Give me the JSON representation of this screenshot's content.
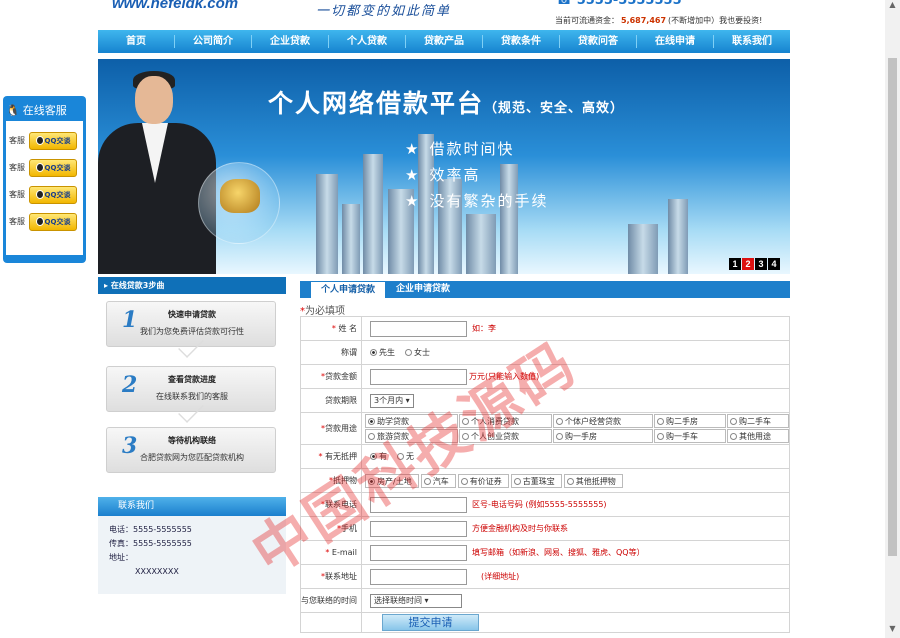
{
  "header": {
    "logo": "www.hefeidk.com",
    "slogan": "一切都变的如此简单",
    "hotline": "5555-5555555",
    "funds_label": "当前可流通资金：",
    "funds_value": "5,687,467",
    "funds_note": "(不断增加中）我也要投资!"
  },
  "nav": [
    "首页",
    "公司简介",
    "企业贷款",
    "个人贷款",
    "贷款产品",
    "贷款条件",
    "贷款问答",
    "在线申请",
    "联系我们"
  ],
  "banner": {
    "title": "个人网络借款平台",
    "subtitle": "（规范、安全、高效）",
    "points": [
      "借款时间快",
      "效率高",
      "没有繁杂的手续"
    ],
    "pages": [
      "1",
      "2",
      "3",
      "4"
    ]
  },
  "qq": {
    "title": "在线客服",
    "items": [
      {
        "label": "客服",
        "btn": "QQ交谈"
      },
      {
        "label": "客服",
        "btn": "QQ交谈"
      },
      {
        "label": "客服",
        "btn": "QQ交谈"
      },
      {
        "label": "客服",
        "btn": "QQ交谈"
      }
    ]
  },
  "steps": {
    "title": "在线贷款3步曲",
    "items": [
      {
        "num": "1",
        "title": "快速申请贷款",
        "desc": "我们为您免费评估贷款可行性"
      },
      {
        "num": "2",
        "title": "查看贷款进度",
        "desc": "在线联系我们的客服"
      },
      {
        "num": "3",
        "title": "等待机构联络",
        "desc": "合肥贷款网为您匹配贷款机构"
      }
    ]
  },
  "contact": {
    "title": "联系我们",
    "phone": "电话：5555-5555555",
    "fax": "传真：5555-5555555",
    "address_label": "地址：",
    "address": "XXXXXXXX"
  },
  "form": {
    "tabs": [
      "个人申请贷款",
      "企业申请贷款"
    ],
    "required_note": "为必填项",
    "name_label": "姓 名",
    "name_hint": "如：李",
    "title_label": "称谓",
    "title_opts": [
      "先生",
      "女士"
    ],
    "amount_label": "贷款金额",
    "amount_hint": "万元(只能输入数值)",
    "term_label": "贷款期限",
    "term_value": "3个月内",
    "use_label": "贷款用途",
    "use_opts": [
      "助学贷款",
      "个人消费贷款",
      "个体户经营贷款",
      "购二手房",
      "购二手车",
      "旅游贷款",
      "个人创业贷款",
      "购一手房",
      "购一手车",
      "其他用途"
    ],
    "mortgage_label": "有无抵押",
    "mortgage_opts": [
      "有",
      "无"
    ],
    "collateral_label": "抵押物",
    "collateral_opts": [
      "房产/土地",
      "汽车",
      "有价证券",
      "古董珠宝",
      "其他抵押物"
    ],
    "phone_label": "联系电话",
    "phone_hint": "区号-电话号码 (例如5555-5555555)",
    "mobile_label": "手机",
    "mobile_hint": "方便金融机构及时与你联系",
    "email_label": "E-mail",
    "email_hint": "填写邮箱（如新浪、网易、搜狐、雅虎、QQ等）",
    "addr_label": "联系地址",
    "addr_hint": "(详细地址)",
    "time_label": "与您联络的时间",
    "time_value": "选择联络时间",
    "submit": "提交申请"
  },
  "watermark": "中国科技源码"
}
